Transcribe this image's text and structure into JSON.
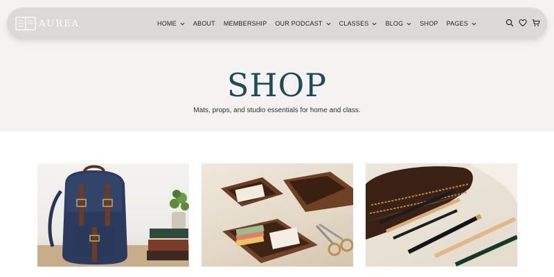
{
  "brand": {
    "name": "AUREA",
    "logo_icon": "open-book-icon"
  },
  "nav": {
    "items": [
      {
        "label": "HOME",
        "has_dropdown": true
      },
      {
        "label": "ABOUT",
        "has_dropdown": false
      },
      {
        "label": "MEMBERSHIP",
        "has_dropdown": false
      },
      {
        "label": "OUR PODCAST",
        "has_dropdown": true
      },
      {
        "label": "CLASSES",
        "has_dropdown": true
      },
      {
        "label": "BLOG",
        "has_dropdown": true
      },
      {
        "label": "SHOP",
        "has_dropdown": false
      },
      {
        "label": "PAGES",
        "has_dropdown": true
      }
    ],
    "icons": [
      "search-icon",
      "heart-icon",
      "cart-icon"
    ]
  },
  "hero": {
    "title": "SHOP",
    "subtitle": "Mats, props, and studio essentials for home and class."
  },
  "products": [
    {
      "image": "navy-canvas-backpack-with-books-and-plant"
    },
    {
      "image": "wooden-desk-trays-with-sticky-notes-and-scissors"
    },
    {
      "image": "leather-pencil-case-with-pens-and-pencils"
    }
  ],
  "colors": {
    "hero_bg": "#f4f3f1",
    "title": "#1e4a5b",
    "navbar_bg": "#dcdad7",
    "text": "#1d2226"
  }
}
